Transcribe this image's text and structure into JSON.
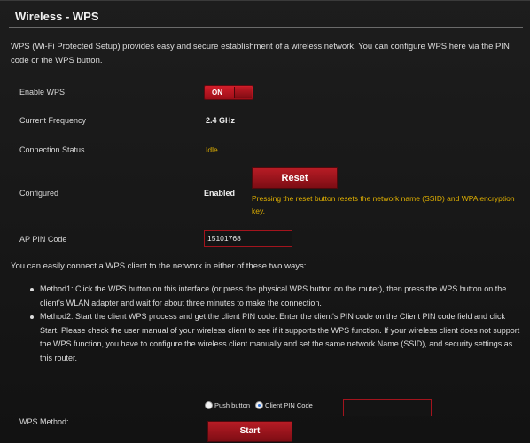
{
  "header": {
    "title": "Wireless - WPS"
  },
  "description": "WPS (Wi-Fi Protected Setup) provides easy and secure establishment of a wireless network. You can configure WPS here via the PIN code or the WPS button.",
  "fields": {
    "enable_wps": {
      "label": "Enable WPS",
      "toggle_text": "ON",
      "value": true
    },
    "current_frequency": {
      "label": "Current Frequency",
      "value": "2.4 GHz"
    },
    "connection_status": {
      "label": "Connection Status",
      "value": "Idle"
    },
    "configured": {
      "label": "Configured",
      "value": "Enabled",
      "reset_label": "Reset",
      "note": "Pressing the reset button resets the network name (SSID) and WPA encryption key."
    },
    "ap_pin_code": {
      "label": "AP PIN Code",
      "value": "15101768"
    }
  },
  "methods_intro": "You can easily connect a WPS client to the network in either of these two ways:",
  "methods": [
    "Method1: Click the WPS button on this interface (or press the physical WPS button on the router), then press the WPS button on the client's WLAN adapter and wait for about three minutes to make the connection.",
    "Method2: Start the client WPS process and get the client PIN code. Enter the client's PIN code on the Client PIN code field and click Start. Please check the user manual of your wireless client to see if it supports the WPS function. If your wireless client does not support the WPS function, you have to configure the wireless client manually and set the same network Name (SSID), and security settings as this router."
  ],
  "wps_method": {
    "label": "WPS Method:",
    "options": [
      "Push button",
      "Client PIN Code"
    ],
    "selected": "Client PIN Code",
    "client_pin_value": "",
    "start_label": "Start"
  },
  "colors": {
    "accent": "#b71c25",
    "status": "#e0b000",
    "background": "#151515"
  }
}
